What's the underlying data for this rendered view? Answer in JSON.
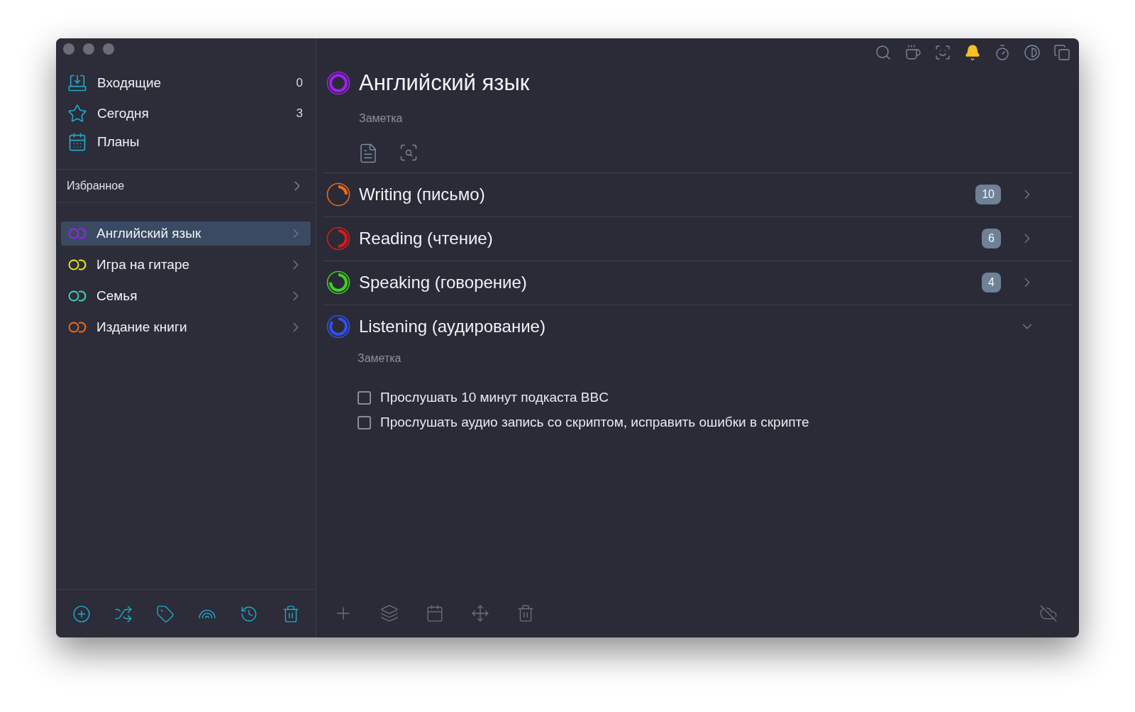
{
  "sidebar": {
    "smart_lists": [
      {
        "kind": "inbox",
        "label": "Входящие",
        "count": "0"
      },
      {
        "kind": "today",
        "label": "Сегодня",
        "count": "3"
      },
      {
        "kind": "plans",
        "label": "Планы"
      }
    ],
    "favorites": {
      "label": "Избранное"
    },
    "areas": [
      {
        "label": "Английский язык",
        "color": "#a020f0",
        "selected": true
      },
      {
        "label": "Игра на гитаре",
        "color": "#e8e020",
        "selected": false
      },
      {
        "label": "Семья",
        "color": "#40d0b8",
        "selected": false
      },
      {
        "label": "Издание книги",
        "color": "#f06a1a",
        "selected": false
      }
    ]
  },
  "header": {
    "title": "Английский язык",
    "color": "#a020f0",
    "note": "Заметка"
  },
  "projects": [
    {
      "title": "Writing (письмо)",
      "color": "#f06a1a",
      "level": 0.25,
      "count": "10",
      "expanded": false
    },
    {
      "title": "Reading (чтение)",
      "color": "#e01818",
      "level": 0.5,
      "count": "6",
      "expanded": false
    },
    {
      "title": "Speaking (говорение)",
      "color": "#40d020",
      "level": 0.75,
      "count": "4",
      "expanded": false
    },
    {
      "title": "Listening (аудирование)",
      "color": "#3050f0",
      "level": 0.85,
      "expanded": true,
      "note": "Заметка",
      "tasks": [
        {
          "label": "Прослушать 10 минут подкаста BBC",
          "checked": false
        },
        {
          "label": "Прослушать аудио запись со скриптом, исправить ошибки в скрипте",
          "checked": false
        }
      ]
    }
  ]
}
